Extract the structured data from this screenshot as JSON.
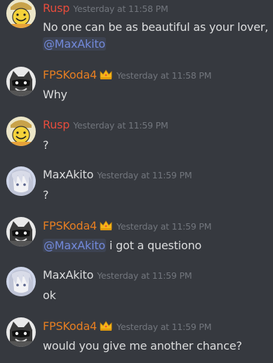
{
  "colors": {
    "background": "#36393f",
    "rusp_name": "#e74c3c",
    "fps_name": "#e67e22",
    "max_name": "#dcddde",
    "timestamp": "#72767d",
    "mention": "#7289da",
    "text": "#dcddde"
  },
  "messages": [
    {
      "author": "Rusp",
      "timestamp": "Yesterday at 11:58 PM",
      "avatar_icon": "yellow-smiley-avatar",
      "line1": "No one can be as beautiful as your lover,",
      "mention": "@MaxAkito"
    },
    {
      "author": "FPSKoda4",
      "timestamp": "Yesterday at 11:58 PM",
      "avatar_icon": "raccoon-avatar",
      "badge_icon": "crown-icon",
      "text": "Why"
    },
    {
      "author": "Rusp",
      "timestamp": "Yesterday at 11:59 PM",
      "avatar_icon": "yellow-smiley-avatar",
      "text": "?"
    },
    {
      "author": "MaxAkito",
      "timestamp": "Yesterday at 11:59 PM",
      "avatar_icon": "anime-avatar",
      "text": "?"
    },
    {
      "author": "FPSKoda4",
      "timestamp": "Yesterday at 11:59 PM",
      "avatar_icon": "raccoon-avatar",
      "badge_icon": "crown-icon",
      "mention": "@MaxAkito",
      "text": " i got a questiono"
    },
    {
      "author": "MaxAkito",
      "timestamp": "Yesterday at 11:59 PM",
      "avatar_icon": "anime-avatar",
      "text": "ok"
    },
    {
      "author": "FPSKoda4",
      "timestamp": "Yesterday at 11:59 PM",
      "avatar_icon": "raccoon-avatar",
      "badge_icon": "crown-icon",
      "text": "would you give me another chance?"
    }
  ]
}
